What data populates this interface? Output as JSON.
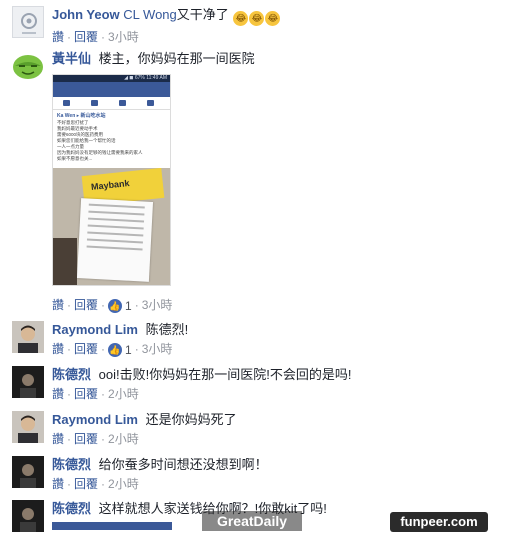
{
  "ui": {
    "reply_label": "讚",
    "reply2_label": "回覆",
    "separator": "·"
  },
  "comments": [
    {
      "author": "John Yeow",
      "mention": "CL Wong",
      "text": "又干净了",
      "emojis": [
        "😂",
        "😂",
        "😂"
      ],
      "time": "3小時",
      "avatar": "gear-avatar"
    },
    {
      "author": "黃半仙",
      "text": "楼主，你妈妈在那一间医院",
      "time": "3小時",
      "likes": "1",
      "avatar": "green-face-avatar",
      "photo": {
        "status": "◢ ◼ 67% 11:49 AM",
        "post_author": "Ka Wen ▸ 新山吃水站",
        "post_lines": [
          "不好意思打扰了",
          "我妈妈最近要动手术",
          "需要6000块的医药费用",
          "如果您们能给我一个帮忙的话",
          "一人一点力量",
          "因为我妈妈没有足够的钱让需要我来的家人",
          "如果不愿意也关..."
        ],
        "brand": "Maybank"
      }
    },
    {
      "author": "Raymond Lim",
      "text": "陈德烈!",
      "time": "3小時",
      "likes": "1",
      "avatar": "man-avatar"
    },
    {
      "author": "陈德烈",
      "text": "ooi!击败!你妈妈在那一间医院!不会回的是吗!",
      "time": "2小時",
      "avatar": "dark-avatar"
    },
    {
      "author": "Raymond Lim",
      "text": "还是你妈妈死了",
      "time": "2小時",
      "avatar": "man-avatar"
    },
    {
      "author": "陈德烈",
      "text": "给你蚕多时间想还没想到啊！",
      "time": "2小時",
      "avatar": "dark-avatar"
    },
    {
      "author": "陈德烈",
      "text": "这样就想人家送钱给你啊？!你敢kit了吗!",
      "avatar": "dark-avatar"
    }
  ],
  "watermarks": {
    "left": "GreatDaily",
    "right": "funpeer.com"
  }
}
